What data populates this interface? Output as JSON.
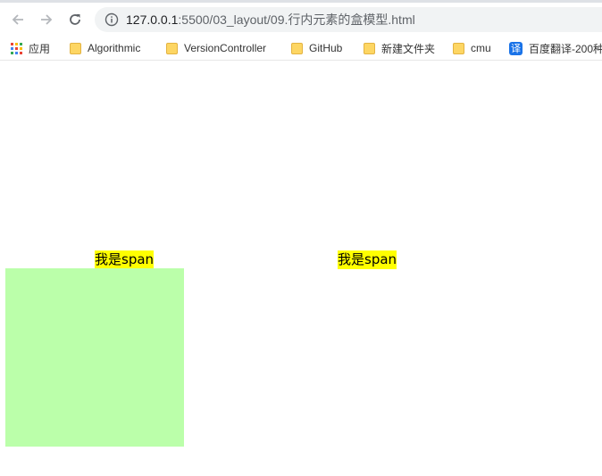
{
  "browser": {
    "url_host": "127.0.0.1",
    "url_path": ":5500/03_layout/09.行内元素的盒模型.html"
  },
  "bookmarks": [
    {
      "label": "应用",
      "icon": "apps-grid-icon"
    },
    {
      "label": "Algorithmic",
      "icon": "folder-icon"
    },
    {
      "label": "VersionController",
      "icon": "folder-icon"
    },
    {
      "label": "GitHub",
      "icon": "folder-icon"
    },
    {
      "label": "新建文件夹",
      "icon": "folder-icon"
    },
    {
      "label": "cmu",
      "icon": "folder-icon"
    },
    {
      "label": "百度翻译-200种",
      "icon": "translate-icon"
    }
  ],
  "translate_icon_glyph": "译",
  "page": {
    "span1_text": "我是span",
    "span2_text": "我是span"
  },
  "colors": {
    "span_bg": "#ffff00",
    "box_bg": "#bbffaa"
  }
}
